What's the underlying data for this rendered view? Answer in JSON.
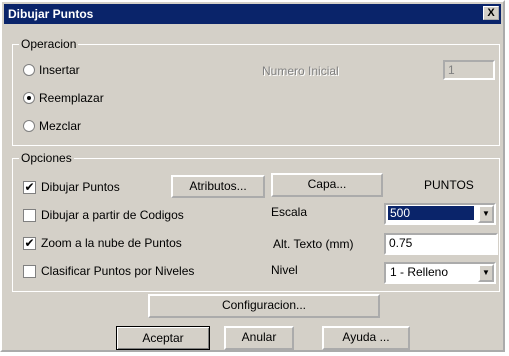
{
  "window": {
    "title": "Dibujar Puntos",
    "close_symbol": "X"
  },
  "operacion": {
    "legend": "Operacion",
    "options": [
      {
        "label": "Insertar",
        "selected": false
      },
      {
        "label": "Reemplazar",
        "selected": true
      },
      {
        "label": "Mezclar",
        "selected": false
      }
    ],
    "numero_inicial_label": "Numero Inicial",
    "numero_inicial_value": "1"
  },
  "opciones": {
    "legend": "Opciones",
    "checks": [
      {
        "label": "Dibujar Puntos",
        "checked": true
      },
      {
        "label": "Dibujar a partir de Codigos",
        "checked": false
      },
      {
        "label": "Zoom a la nube de Puntos",
        "checked": true
      },
      {
        "label": "Clasificar Puntos por Niveles",
        "checked": false
      }
    ],
    "atributos_button": "Atributos...",
    "capa_button": "Capa...",
    "capa_value": "PUNTOS",
    "escala_label": "Escala",
    "escala_value": "500",
    "alt_texto_label": "Alt. Texto (mm)",
    "alt_texto_value": "0.75",
    "nivel_label": "Nivel",
    "nivel_value": "1 - Relleno"
  },
  "buttons": {
    "configuracion": "Configuracion...",
    "aceptar": "Aceptar",
    "anular": "Anular",
    "ayuda": "Ayuda ..."
  },
  "icons": {
    "checkmark": "✔",
    "dropdown": "▼"
  }
}
